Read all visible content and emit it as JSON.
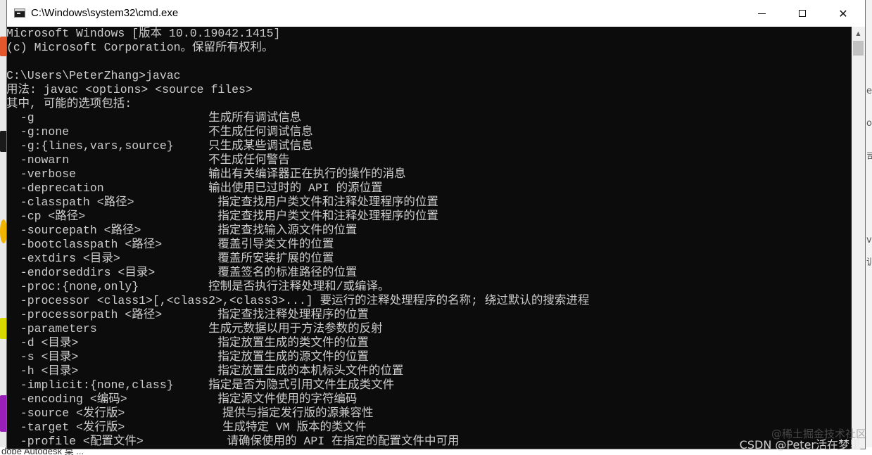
{
  "window": {
    "title": "C:\\Windows\\system32\\cmd.exe",
    "minimize_glyph": "—",
    "maximize_glyph": "□",
    "close_glyph": "✕"
  },
  "console_lines": [
    "Microsoft Windows [版本 10.0.19042.1415]",
    "(c) Microsoft Corporation。保留所有权利。",
    "",
    "C:\\Users\\PeterZhang>javac",
    "用法: javac <options> <source files>",
    "其中, 可能的选项包括:",
    "  -g                         生成所有调试信息",
    "  -g:none                    不生成任何调试信息",
    "  -g:{lines,vars,source}     只生成某些调试信息",
    "  -nowarn                    不生成任何警告",
    "  -verbose                   输出有关编译器正在执行的操作的消息",
    "  -deprecation               输出使用已过时的 API 的源位置",
    "  -classpath <路径>            指定查找用户类文件和注释处理程序的位置",
    "  -cp <路径>                   指定查找用户类文件和注释处理程序的位置",
    "  -sourcepath <路径>           指定查找输入源文件的位置",
    "  -bootclasspath <路径>        覆盖引导类文件的位置",
    "  -extdirs <目录>              覆盖所安装扩展的位置",
    "  -endorseddirs <目录>         覆盖签名的标准路径的位置",
    "  -proc:{none,only}          控制是否执行注释处理和/或编译。",
    "  -processor <class1>[,<class2>,<class3>...] 要运行的注释处理程序的名称; 绕过默认的搜索进程",
    "  -processorpath <路径>        指定查找注释处理程序的位置",
    "  -parameters                生成元数据以用于方法参数的反射",
    "  -d <目录>                    指定放置生成的类文件的位置",
    "  -s <目录>                    指定放置生成的源文件的位置",
    "  -h <目录>                    指定放置生成的本机标头文件的位置",
    "  -implicit:{none,class}     指定是否为隐式引用文件生成类文件",
    "  -encoding <编码>             指定源文件使用的字符编码",
    "  -source <发行版>              提供与指定发行版的源兼容性",
    "  -target <发行版>              生成特定 VM 版本的类文件",
    "  -profile <配置文件>            请确保使用的 API 在指定的配置文件中可用"
  ],
  "watermark": {
    "line1": "@稀土掘金技术社区",
    "line2": "CSDN @Peter活在梦里"
  },
  "desktop": {
    "bottom_text": "dobe    Autodesk 桌 ...",
    "right_chars": [
      "e",
      "o",
      "司",
      "va",
      "训"
    ]
  },
  "colors": {
    "console_bg": "#0c0c0c",
    "console_fg": "#cccccc",
    "titlebar_bg": "#ffffff"
  }
}
